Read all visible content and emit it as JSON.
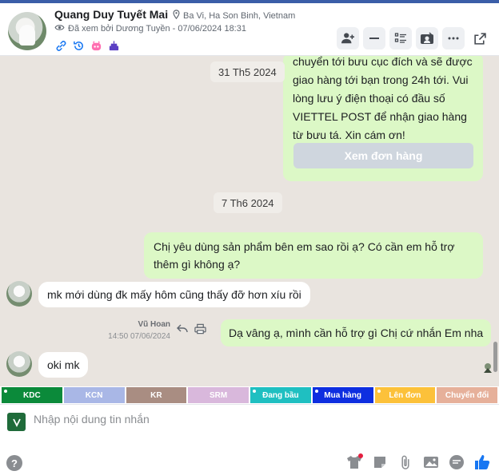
{
  "header": {
    "name": "Quang Duy Tuyết Mai",
    "location": "Ba Vi, Ha Son Binh, Vietnam",
    "seen_by": "Đã xem bởi Dương Tuyền - 07/06/2024 18:31"
  },
  "chat": {
    "date1": "31 Th5 2024",
    "order_text": "chuyển tới bưu cục đích và sẽ được giao hàng tới bạn trong 24h tới. Vui lòng lưu ý điện thoại có đầu số VIETTEL POST để nhận giao hàng từ bưu tá. Xin cám ơn!",
    "order_button": "Xem đơn hàng",
    "date2": "7 Th6 2024",
    "msg1": "Chị yêu dùng sản phẩm bên em sao rồi ạ? Có cần em hỗ trợ thêm gì không ạ?",
    "msg2": "mk mới dùng đk mấy hôm cũng thấy đỡ hơn xíu rồi",
    "msg3_sender": "Vũ Hoan",
    "msg3_time": "14:50 07/06/2024",
    "msg3": "Dạ vâng ạ, mình cần hỗ trợ gì Chị cứ nhắn Em nha",
    "msg4": "oki mk"
  },
  "tags": [
    {
      "label": "KDC",
      "color": "#0b8a3a",
      "dot": true
    },
    {
      "label": "KCN",
      "color": "#a9b7e6",
      "dot": false
    },
    {
      "label": "KR",
      "color": "#a98d82",
      "dot": false
    },
    {
      "label": "SRM",
      "color": "#d9b8dc",
      "dot": false
    },
    {
      "label": "Đang bầu",
      "color": "#1fbfc1",
      "dot": true
    },
    {
      "label": "Mua hàng",
      "color": "#0e2ee0",
      "dot": true
    },
    {
      "label": "Lên đơn",
      "color": "#fcc13a",
      "dot": true
    },
    {
      "label": "Chuyển đổi",
      "color": "#e6b09a",
      "dot": false
    }
  ],
  "composer": {
    "placeholder": "Nhập nội dung tin nhắn"
  },
  "colors": {
    "accent": "#3b5ea8",
    "chat_bg": "#e9e4df",
    "outgoing_bubble": "#dcf8c6",
    "like_blue": "#1877f2"
  },
  "icons": [
    "location-icon",
    "eye-icon",
    "link-icon",
    "history-icon",
    "mascot-icon",
    "cake-icon",
    "add-person-icon",
    "minimize-icon",
    "list-icon",
    "contact-card-icon",
    "more-icon",
    "external-link-icon",
    "reply-icon",
    "print-icon",
    "help-icon",
    "tshirt-icon",
    "sticker-icon",
    "attachment-icon",
    "image-icon",
    "quick-reply-icon",
    "like-icon"
  ]
}
